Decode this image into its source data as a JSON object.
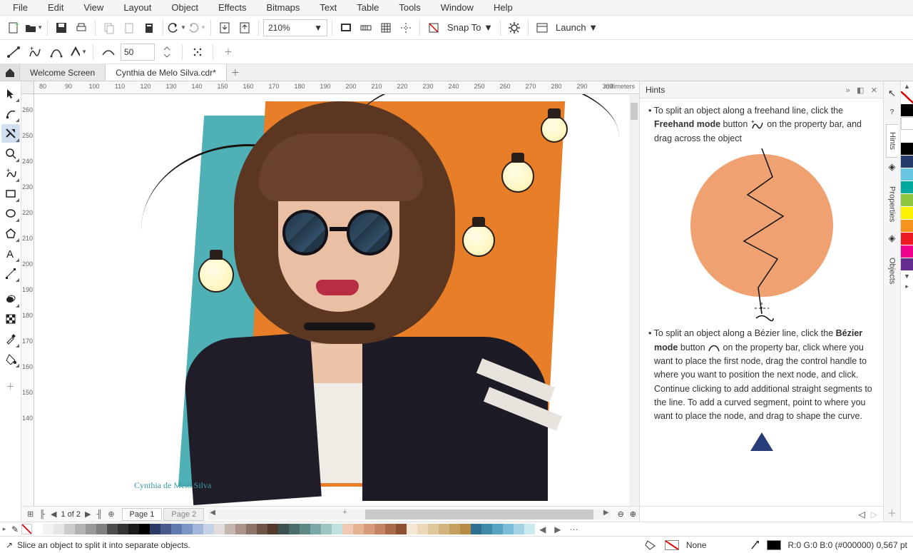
{
  "menu": [
    "File",
    "Edit",
    "View",
    "Layout",
    "Object",
    "Effects",
    "Bitmaps",
    "Text",
    "Table",
    "Tools",
    "Window",
    "Help"
  ],
  "toolbar": {
    "zoom": "210%",
    "snap_label": "Snap To",
    "launch_label": "Launch"
  },
  "propbar": {
    "freehand_smoothing": "50"
  },
  "tabs": {
    "welcome": "Welcome Screen",
    "doc": "Cynthia de Melo Silva.cdr*"
  },
  "ruler": {
    "unit": "millimeters",
    "h": [
      "80",
      "90",
      "100",
      "110",
      "120",
      "130",
      "140",
      "150",
      "160",
      "170",
      "180",
      "190",
      "200",
      "210",
      "220",
      "230",
      "240",
      "250",
      "260",
      "270",
      "280",
      "290",
      "300"
    ],
    "v": [
      "260",
      "250",
      "240",
      "230",
      "220",
      "210",
      "200",
      "190",
      "180",
      "170",
      "160",
      "150",
      "140"
    ]
  },
  "artwork": {
    "signature": "Cynthia  de Melo Silva"
  },
  "hints": {
    "title": "Hints",
    "p1a": "To split an object along a freehand line, click the ",
    "p1b": "Freehand mode",
    "p1c": " button ",
    "p1d": " on the property bar, and drag across the object",
    "p2a": "To split an object along a Bézier line, click the ",
    "p2b": "Bézier mode",
    "p2c": " button ",
    "p2d": " on the property bar, click where you want to place the first node, drag the control handle to where you want to position the next node, and click. Continue clicking to add additional straight segments to the line. To add a curved segment, point to where you want to place the node, and drag to shape the curve."
  },
  "rstrip": {
    "tab_hints": "Hints",
    "tab_props": "Properties",
    "tab_objects": "Objects"
  },
  "pages": {
    "counter": "1 of 2",
    "page1": "Page 1",
    "page2": "Page 2"
  },
  "status": {
    "hint": "Slice an object to split it into separate objects.",
    "fill_label": "None",
    "outline_label": "R:0 G:0 B:0 (#000000)  0,567 pt"
  },
  "palette_v": [
    "#ffffff",
    "#000000",
    "#243b6b",
    "#67c7e2",
    "#00a99d",
    "#8cc63f",
    "#fff200",
    "#f7941e",
    "#ed1c24",
    "#ec008c",
    "#662d91"
  ],
  "palette_h": [
    "#ffffff",
    "#f2f2f2",
    "#e6e6e6",
    "#cccccc",
    "#b3b3b3",
    "#999999",
    "#808080",
    "#4d4d4d",
    "#333333",
    "#1a1a1a",
    "#000000",
    "#2b3a67",
    "#4a5a8c",
    "#5f7bb0",
    "#7c96c5",
    "#a2b6d8",
    "#c5d2e8",
    "#e3dcdc",
    "#c4b7b0",
    "#a9958a",
    "#8d746a",
    "#6e5447",
    "#523a2f",
    "#3c5150",
    "#4c6d6c",
    "#5d8886",
    "#7aa8a6",
    "#9cc6c4",
    "#c0e1df",
    "#efc9b1",
    "#e4b295",
    "#d59b7b",
    "#c48361",
    "#a96a4a",
    "#8d5134",
    "#f5e7d3",
    "#ecd7b8",
    "#e0c69b",
    "#d3b37d",
    "#c5a060",
    "#b68c45",
    "#2f6f8f",
    "#4189a9",
    "#5aa3c0",
    "#7cbcd4",
    "#a4d4e4",
    "#cce9f0"
  ]
}
